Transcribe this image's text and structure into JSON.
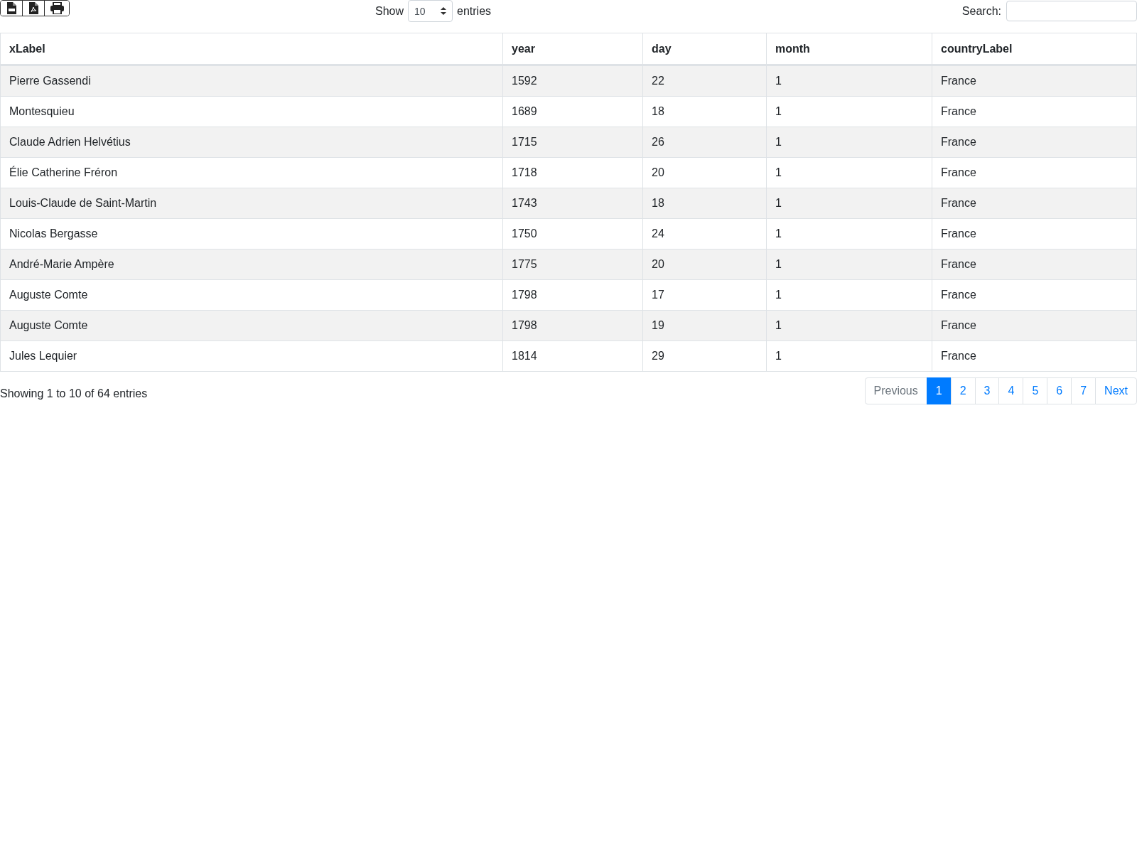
{
  "toolbar": {
    "buttons": [
      {
        "kind": "csv"
      },
      {
        "kind": "pdf"
      },
      {
        "kind": "print"
      }
    ]
  },
  "length": {
    "label_before": "Show",
    "value": "10",
    "label_after": "entries"
  },
  "search": {
    "label": "Search:"
  },
  "table": {
    "columns": [
      "xLabel",
      "year",
      "day",
      "month",
      "countryLabel"
    ],
    "rows": [
      [
        "Pierre Gassendi",
        "1592",
        "22",
        "1",
        "France"
      ],
      [
        "Montesquieu",
        "1689",
        "18",
        "1",
        "France"
      ],
      [
        "Claude Adrien Helvétius",
        "1715",
        "26",
        "1",
        "France"
      ],
      [
        "Élie Catherine Fréron",
        "1718",
        "20",
        "1",
        "France"
      ],
      [
        "Louis-Claude de Saint-Martin",
        "1743",
        "18",
        "1",
        "France"
      ],
      [
        "Nicolas Bergasse",
        "1750",
        "24",
        "1",
        "France"
      ],
      [
        "André-Marie Ampère",
        "1775",
        "20",
        "1",
        "France"
      ],
      [
        "Auguste Comte",
        "1798",
        "17",
        "1",
        "France"
      ],
      [
        "Auguste Comte",
        "1798",
        "19",
        "1",
        "France"
      ],
      [
        "Jules Lequier",
        "1814",
        "29",
        "1",
        "France"
      ]
    ]
  },
  "info": "Showing 1 to 10 of 64 entries",
  "pagination": [
    {
      "label": "Previous",
      "disabled": true,
      "selected": false
    },
    {
      "label": "1",
      "disabled": false,
      "selected": true
    },
    {
      "label": "2",
      "disabled": false,
      "selected": false
    },
    {
      "label": "3",
      "disabled": false,
      "selected": false
    },
    {
      "label": "4",
      "disabled": false,
      "selected": false
    },
    {
      "label": "5",
      "disabled": false,
      "selected": false
    },
    {
      "label": "6",
      "disabled": false,
      "selected": false
    },
    {
      "label": "7",
      "disabled": false,
      "selected": false
    },
    {
      "label": "Next",
      "disabled": false,
      "selected": false
    }
  ]
}
